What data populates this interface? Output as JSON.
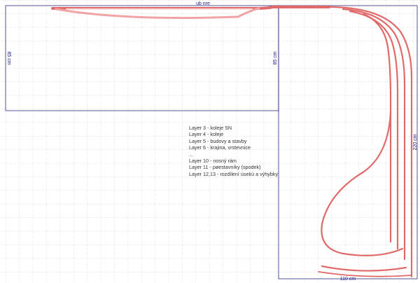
{
  "dimensions": {
    "left_panel_depth": "85 cm",
    "inner_depth": "85 cm",
    "right_leg_length": "220 cm",
    "bottom_width": "110 cm",
    "top_label": "ub nre"
  },
  "legend": [
    "Layer 3 - koleje SN",
    "Layer 4 - koleje",
    "Layer 5 - budovy a stavby",
    "Layer 6 - krajina, vrstevnice",
    "...",
    "Layer 10 - nosný rám",
    "Layer 11 - pøestavníky (spodek)",
    "Layer 12,13 - rozdìlení úsekù a výhybky"
  ],
  "colors": {
    "grid": "#c8c8c8",
    "frame": "#2a2a7a",
    "track": "#e06a6a",
    "track_fill": "#f8d9d9"
  }
}
